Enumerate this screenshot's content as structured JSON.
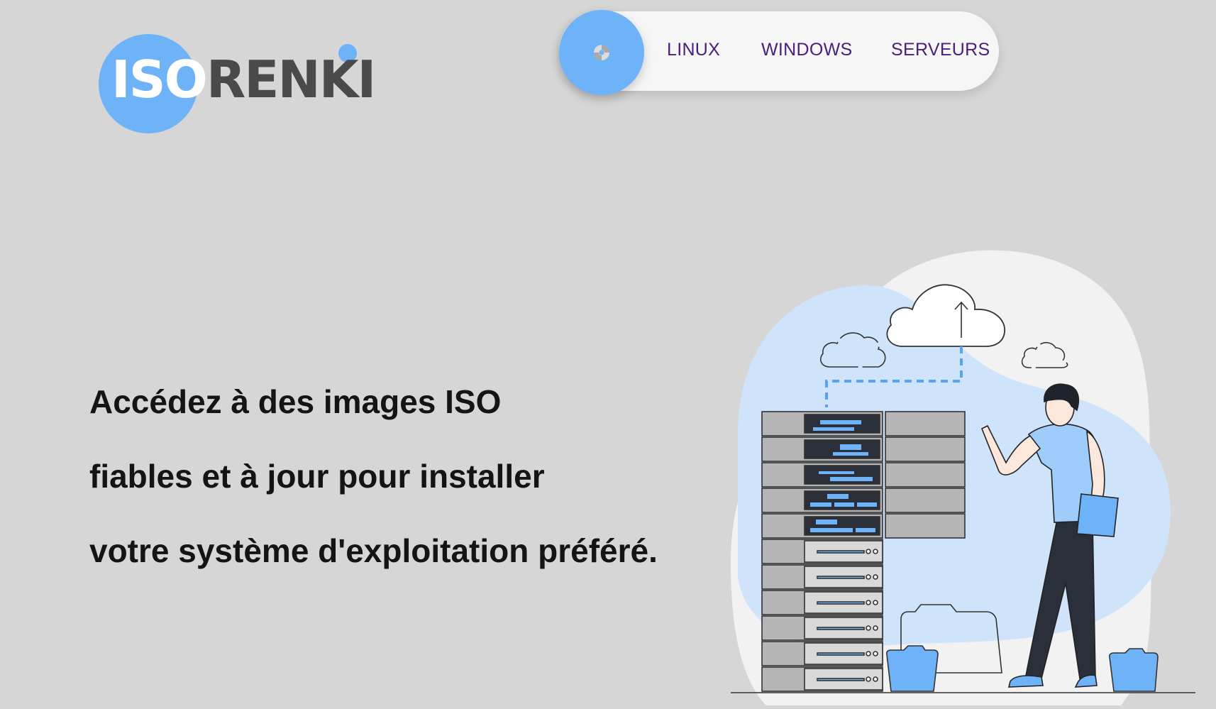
{
  "brand": {
    "logo_part1": "ISO",
    "logo_part2": "RENKI"
  },
  "nav": {
    "items": [
      {
        "label": "LINUX"
      },
      {
        "label": "WINDOWS"
      },
      {
        "label": "SERVEURS"
      }
    ],
    "home_icon": "disc-icon"
  },
  "hero": {
    "lines": [
      "Accédez à des images ISO",
      "fiables et à jour pour installer",
      "votre système d'exploitation préféré."
    ]
  },
  "colors": {
    "background": "#d6d6d6",
    "accent": "#6eb3f7",
    "nav_text": "#4a1e7c",
    "heading_text": "#141414"
  },
  "illustration": {
    "subject": "server-rack-cloud-upload-person"
  }
}
